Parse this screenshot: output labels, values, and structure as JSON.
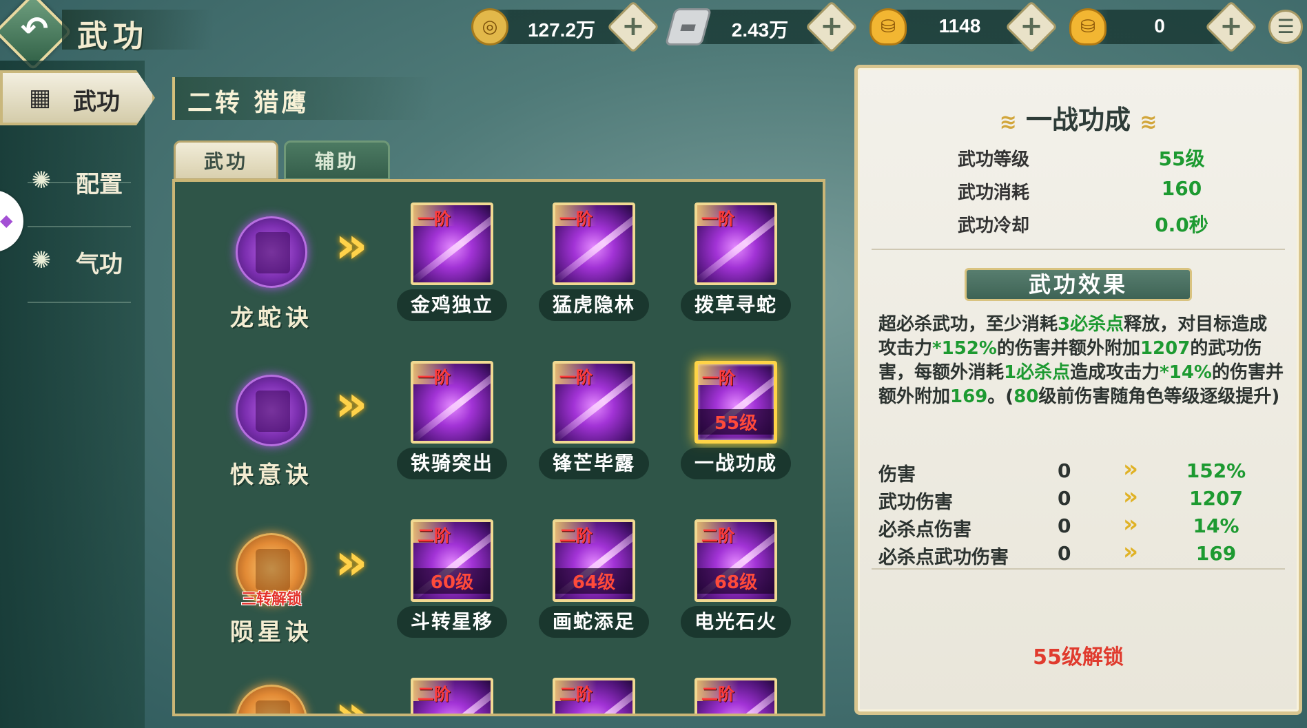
{
  "header": {
    "title": "武功",
    "back_icon": "back-arrow-icon",
    "menu_icon": "list-menu-icon"
  },
  "currencies": [
    {
      "name": "copper-coin",
      "icon": "coin-icon",
      "value": "127.2万",
      "color": "#e2b84a"
    },
    {
      "name": "silver",
      "icon": "silver-ingot-icon",
      "value": "2.43万",
      "color": "#cfd3d6"
    },
    {
      "name": "gold-locked",
      "icon": "gold-ingot-lock-icon",
      "value": "1148",
      "color": "#f2b632"
    },
    {
      "name": "gold",
      "icon": "gold-ingot-icon",
      "value": "0",
      "color": "#f2b632"
    }
  ],
  "sidebar": {
    "items": [
      {
        "label": "武功",
        "icon": "cards-icon",
        "active": true
      },
      {
        "label": "配置",
        "icon": "swirl-icon",
        "active": false
      },
      {
        "label": "气功",
        "icon": "swirl-icon",
        "active": false
      }
    ]
  },
  "class_header": "二转 猎鹰",
  "tabs": [
    {
      "label": "武功",
      "active": true
    },
    {
      "label": "辅助",
      "active": false
    }
  ],
  "rows": [
    {
      "label": "龙蛇诀",
      "locked": false,
      "lock_text": "",
      "skills": [
        {
          "tier": "一阶",
          "name": "金鸡独立",
          "level": "",
          "selected": false
        },
        {
          "tier": "一阶",
          "name": "猛虎隐林",
          "level": "",
          "selected": false
        },
        {
          "tier": "一阶",
          "name": "拨草寻蛇",
          "level": "",
          "selected": false
        }
      ]
    },
    {
      "label": "快意诀",
      "locked": false,
      "lock_text": "",
      "skills": [
        {
          "tier": "一阶",
          "name": "铁骑突出",
          "level": "",
          "selected": false
        },
        {
          "tier": "一阶",
          "name": "锋芒毕露",
          "level": "",
          "selected": false
        },
        {
          "tier": "一阶",
          "name": "一战功成",
          "level": "55级",
          "selected": true
        }
      ]
    },
    {
      "label": "陨星诀",
      "locked": true,
      "lock_text": "三转解锁",
      "skills": [
        {
          "tier": "二阶",
          "name": "斗转星移",
          "level": "60级",
          "selected": false
        },
        {
          "tier": "二阶",
          "name": "画蛇添足",
          "level": "64级",
          "selected": false
        },
        {
          "tier": "二阶",
          "name": "电光石火",
          "level": "68级",
          "selected": false
        }
      ]
    },
    {
      "label": "",
      "locked": true,
      "lock_text": "",
      "skills": [
        {
          "tier": "二阶",
          "name": "",
          "level": "",
          "selected": false
        },
        {
          "tier": "二阶",
          "name": "",
          "level": "",
          "selected": false
        },
        {
          "tier": "二阶",
          "name": "",
          "level": "",
          "selected": false
        }
      ]
    }
  ],
  "info": {
    "title": "一战功成",
    "stats": [
      {
        "label": "武功等级",
        "value": "55级"
      },
      {
        "label": "武功消耗",
        "value": "160"
      },
      {
        "label": "武功冷却",
        "value": "0.0秒"
      }
    ],
    "effect_title": "武功效果",
    "effect_parts": [
      {
        "text": "超必杀武功，至少消耗",
        "hl": false
      },
      {
        "text": "3必杀点",
        "hl": true
      },
      {
        "text": "释放，对目标造成攻击力",
        "hl": false
      },
      {
        "text": "*152%",
        "hl": true
      },
      {
        "text": "的伤害并额外附加",
        "hl": false
      },
      {
        "text": "1207",
        "hl": true
      },
      {
        "text": "的武功伤害，每额外消耗",
        "hl": false
      },
      {
        "text": "1必杀点",
        "hl": true
      },
      {
        "text": "造成攻击力",
        "hl": false
      },
      {
        "text": "*14%",
        "hl": true
      },
      {
        "text": "的伤害并额外附加",
        "hl": false
      },
      {
        "text": "169",
        "hl": true
      },
      {
        "text": "。(",
        "hl": false
      },
      {
        "text": "80",
        "hl": true
      },
      {
        "text": "级前伤害随角色等级逐级提升)",
        "hl": false
      }
    ],
    "comparisons": [
      {
        "label": "伤害",
        "old": "0",
        "new": "152%"
      },
      {
        "label": "武功伤害",
        "old": "0",
        "new": "1207"
      },
      {
        "label": "必杀点伤害",
        "old": "0",
        "new": "14%"
      },
      {
        "label": "必杀点武功伤害",
        "old": "0",
        "new": "169"
      }
    ],
    "unlock_note": "55级解锁"
  }
}
